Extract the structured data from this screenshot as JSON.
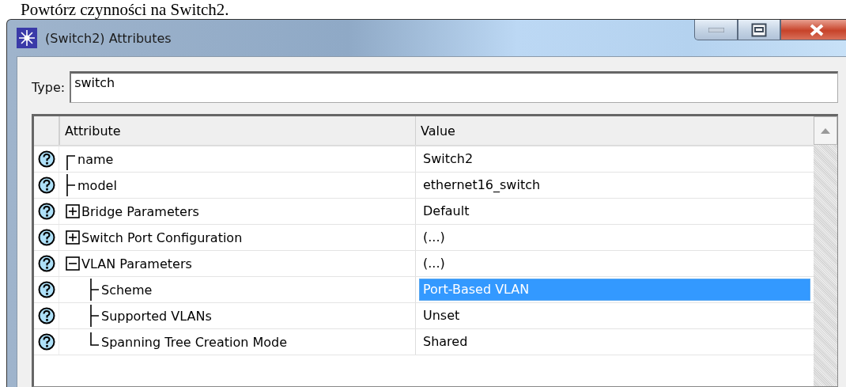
{
  "page_text": "Powtórz czynności na Switch2.",
  "window": {
    "title": "(Switch2) Attributes"
  },
  "type_field": {
    "label": "Type:",
    "value": "switch"
  },
  "table": {
    "columns": [
      "Attribute",
      "Value"
    ],
    "rows": [
      {
        "attribute": "name",
        "value": "Switch2",
        "selected": false
      },
      {
        "attribute": "model",
        "value": "ethernet16_switch",
        "selected": false
      },
      {
        "attribute": "Bridge Parameters",
        "value": "Default",
        "selected": false,
        "expanded": false
      },
      {
        "attribute": "Switch Port Configuration",
        "value": "(...)",
        "selected": false,
        "expanded": false
      },
      {
        "attribute": "VLAN Parameters",
        "value": "(...)",
        "selected": false,
        "expanded": true,
        "children": [
          {
            "attribute": "Scheme",
            "value": "Port-Based VLAN",
            "selected": true
          },
          {
            "attribute": "Supported VLANs",
            "value": "Unset",
            "selected": false
          },
          {
            "attribute": "Spanning Tree Creation Mode",
            "value": "Shared",
            "selected": false
          }
        ]
      }
    ]
  }
}
